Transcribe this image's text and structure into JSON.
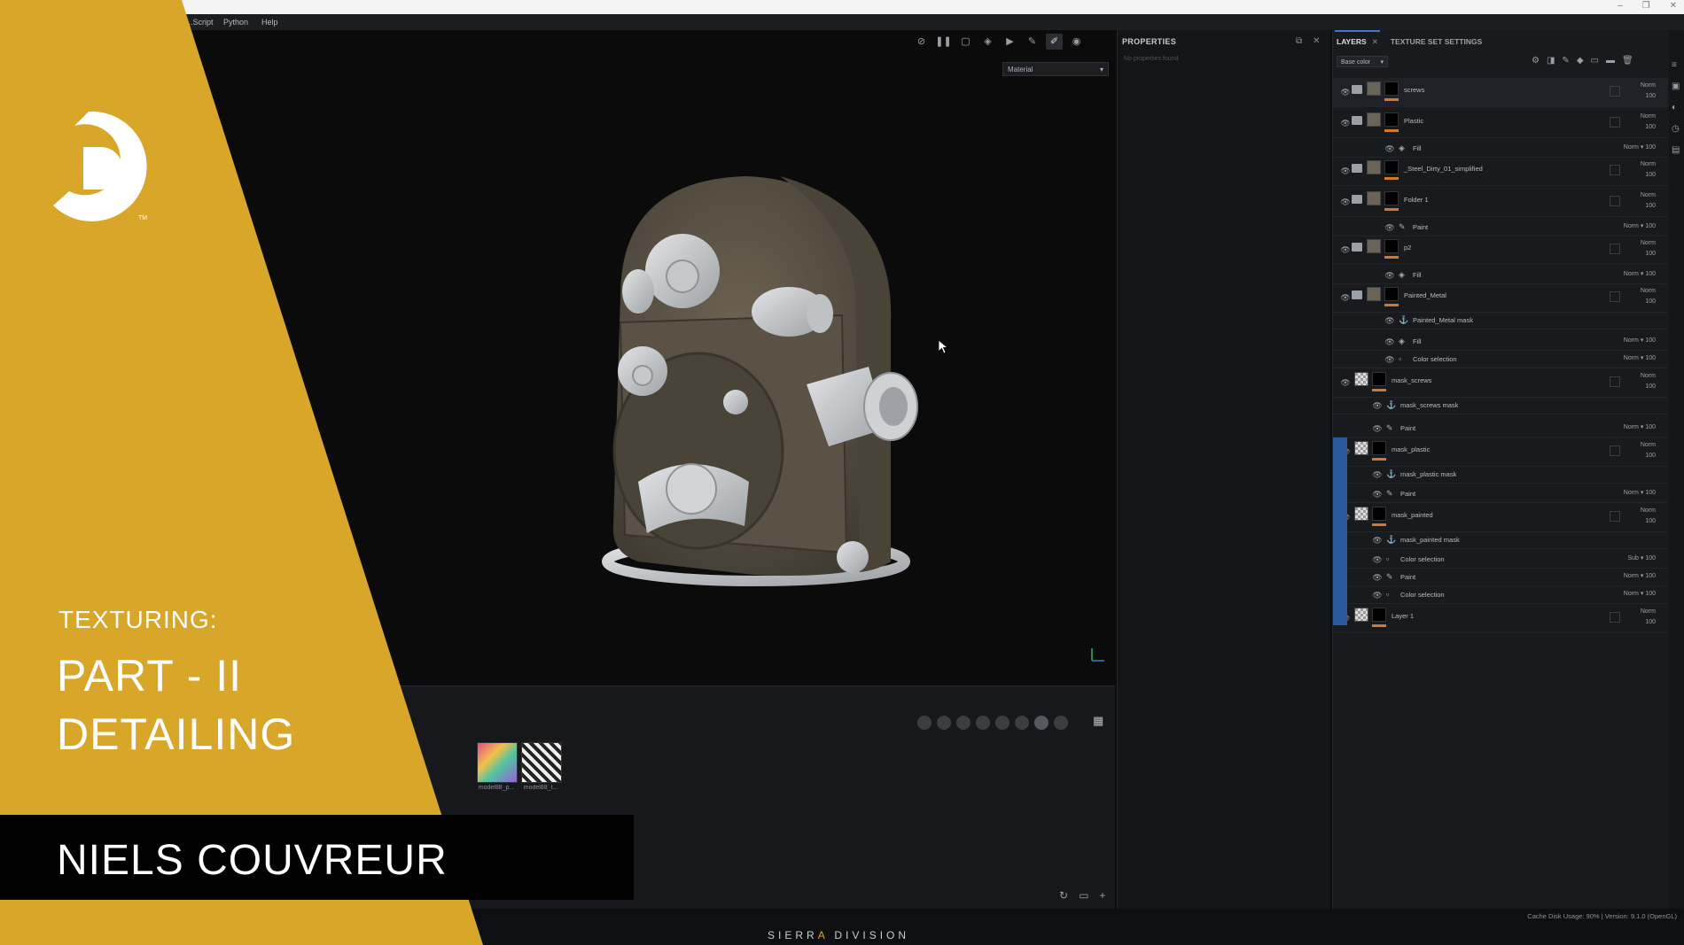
{
  "menu": {
    "items": [
      "...Script",
      "Python",
      "Help"
    ]
  },
  "window": {
    "controls": [
      "–",
      "❐",
      "✕"
    ]
  },
  "viewport": {
    "material_select": "Material",
    "toolbar_icons": [
      "hide-icon",
      "pause-icon",
      "select-icon",
      "cube-icon",
      "camera-icon",
      "brush-settings-icon",
      "paint-brush-icon",
      "screenshot-icon"
    ]
  },
  "shelf": {
    "thumbnails": [
      {
        "label": "model88_p..."
      },
      {
        "label": "model88_t..."
      }
    ]
  },
  "properties": {
    "title": "PROPERTIES",
    "empty_text": "No properties found"
  },
  "layers_panel": {
    "tabs": [
      {
        "label": "LAYERS",
        "active": true
      },
      {
        "label": "TEXTURE SET SETTINGS",
        "active": false
      }
    ],
    "channel": "Base color",
    "rows": [
      {
        "kind": "group",
        "name": "screws",
        "blend": "Norm",
        "opacity": "100",
        "selected": true
      },
      {
        "kind": "group",
        "name": "Plastic",
        "blend": "Norm",
        "opacity": "100"
      },
      {
        "kind": "sub",
        "icon": "fill",
        "name": "Fill",
        "blend": "Norm",
        "opacity": "100"
      },
      {
        "kind": "group",
        "name": "_Steel_Dirty_01_simplified",
        "blend": "Norm",
        "opacity": "100"
      },
      {
        "kind": "group",
        "name": "Folder 1",
        "blend": "Norm",
        "opacity": "100"
      },
      {
        "kind": "sub",
        "icon": "paint",
        "name": "Paint",
        "blend": "Norm",
        "opacity": "100"
      },
      {
        "kind": "group",
        "name": "p2",
        "blend": "Norm",
        "opacity": "100"
      },
      {
        "kind": "sub",
        "icon": "fill",
        "name": "Fill",
        "blend": "Norm",
        "opacity": "100"
      },
      {
        "kind": "group",
        "name": "Painted_Metal",
        "blend": "Norm",
        "opacity": "100"
      },
      {
        "kind": "sub",
        "icon": "anchor",
        "name": "Painted_Metal mask",
        "blend": "",
        "opacity": ""
      },
      {
        "kind": "sub",
        "icon": "fill",
        "name": "Fill",
        "blend": "Norm",
        "opacity": "100"
      },
      {
        "kind": "sub",
        "icon": "colorsel",
        "name": "Color selection",
        "blend": "Norm",
        "opacity": "100"
      },
      {
        "kind": "group",
        "name": "mask_screws",
        "blend": "Norm",
        "opacity": "100"
      },
      {
        "kind": "sub",
        "icon": "anchor",
        "name": "mask_screws mask",
        "blend": "",
        "opacity": ""
      },
      {
        "kind": "sub",
        "icon": "paint",
        "name": "Paint",
        "blend": "Norm",
        "opacity": "100"
      },
      {
        "kind": "group",
        "name": "mask_plastic",
        "blend": "Norm",
        "opacity": "100"
      },
      {
        "kind": "sub",
        "icon": "anchor",
        "name": "mask_plastic mask",
        "blend": "",
        "opacity": ""
      },
      {
        "kind": "sub",
        "icon": "paint",
        "name": "Paint",
        "blend": "Norm",
        "opacity": "100"
      },
      {
        "kind": "group",
        "name": "mask_painted",
        "blend": "Norm",
        "opacity": "100"
      },
      {
        "kind": "sub",
        "icon": "anchor",
        "name": "mask_painted mask",
        "blend": "",
        "opacity": ""
      },
      {
        "kind": "sub",
        "icon": "colorsel",
        "name": "Color selection",
        "blend": "Sub",
        "opacity": "100"
      },
      {
        "kind": "sub",
        "icon": "paint",
        "name": "Paint",
        "blend": "Norm",
        "opacity": "100"
      },
      {
        "kind": "sub",
        "icon": "colorsel",
        "name": "Color selection",
        "blend": "Norm",
        "opacity": "100"
      },
      {
        "kind": "group",
        "name": "Layer 1",
        "blend": "Norm",
        "opacity": "100"
      }
    ]
  },
  "status": {
    "text": "Cache Disk Usage:   90% | Version: 9.1.0 (OpenGL)"
  },
  "overlay": {
    "title_small": "TEXTURING:",
    "title_line1": "PART - II",
    "title_line2": "DETAILING",
    "author": "NIELS COUVREUR",
    "brand_before": "SIERR",
    "brand_accent": "A",
    "brand_after": " DIVISION"
  },
  "colors": {
    "accent_yellow": "#d8a72a",
    "selection_blue": "#2a5a9c",
    "layer_orange": "#d07a2a"
  }
}
